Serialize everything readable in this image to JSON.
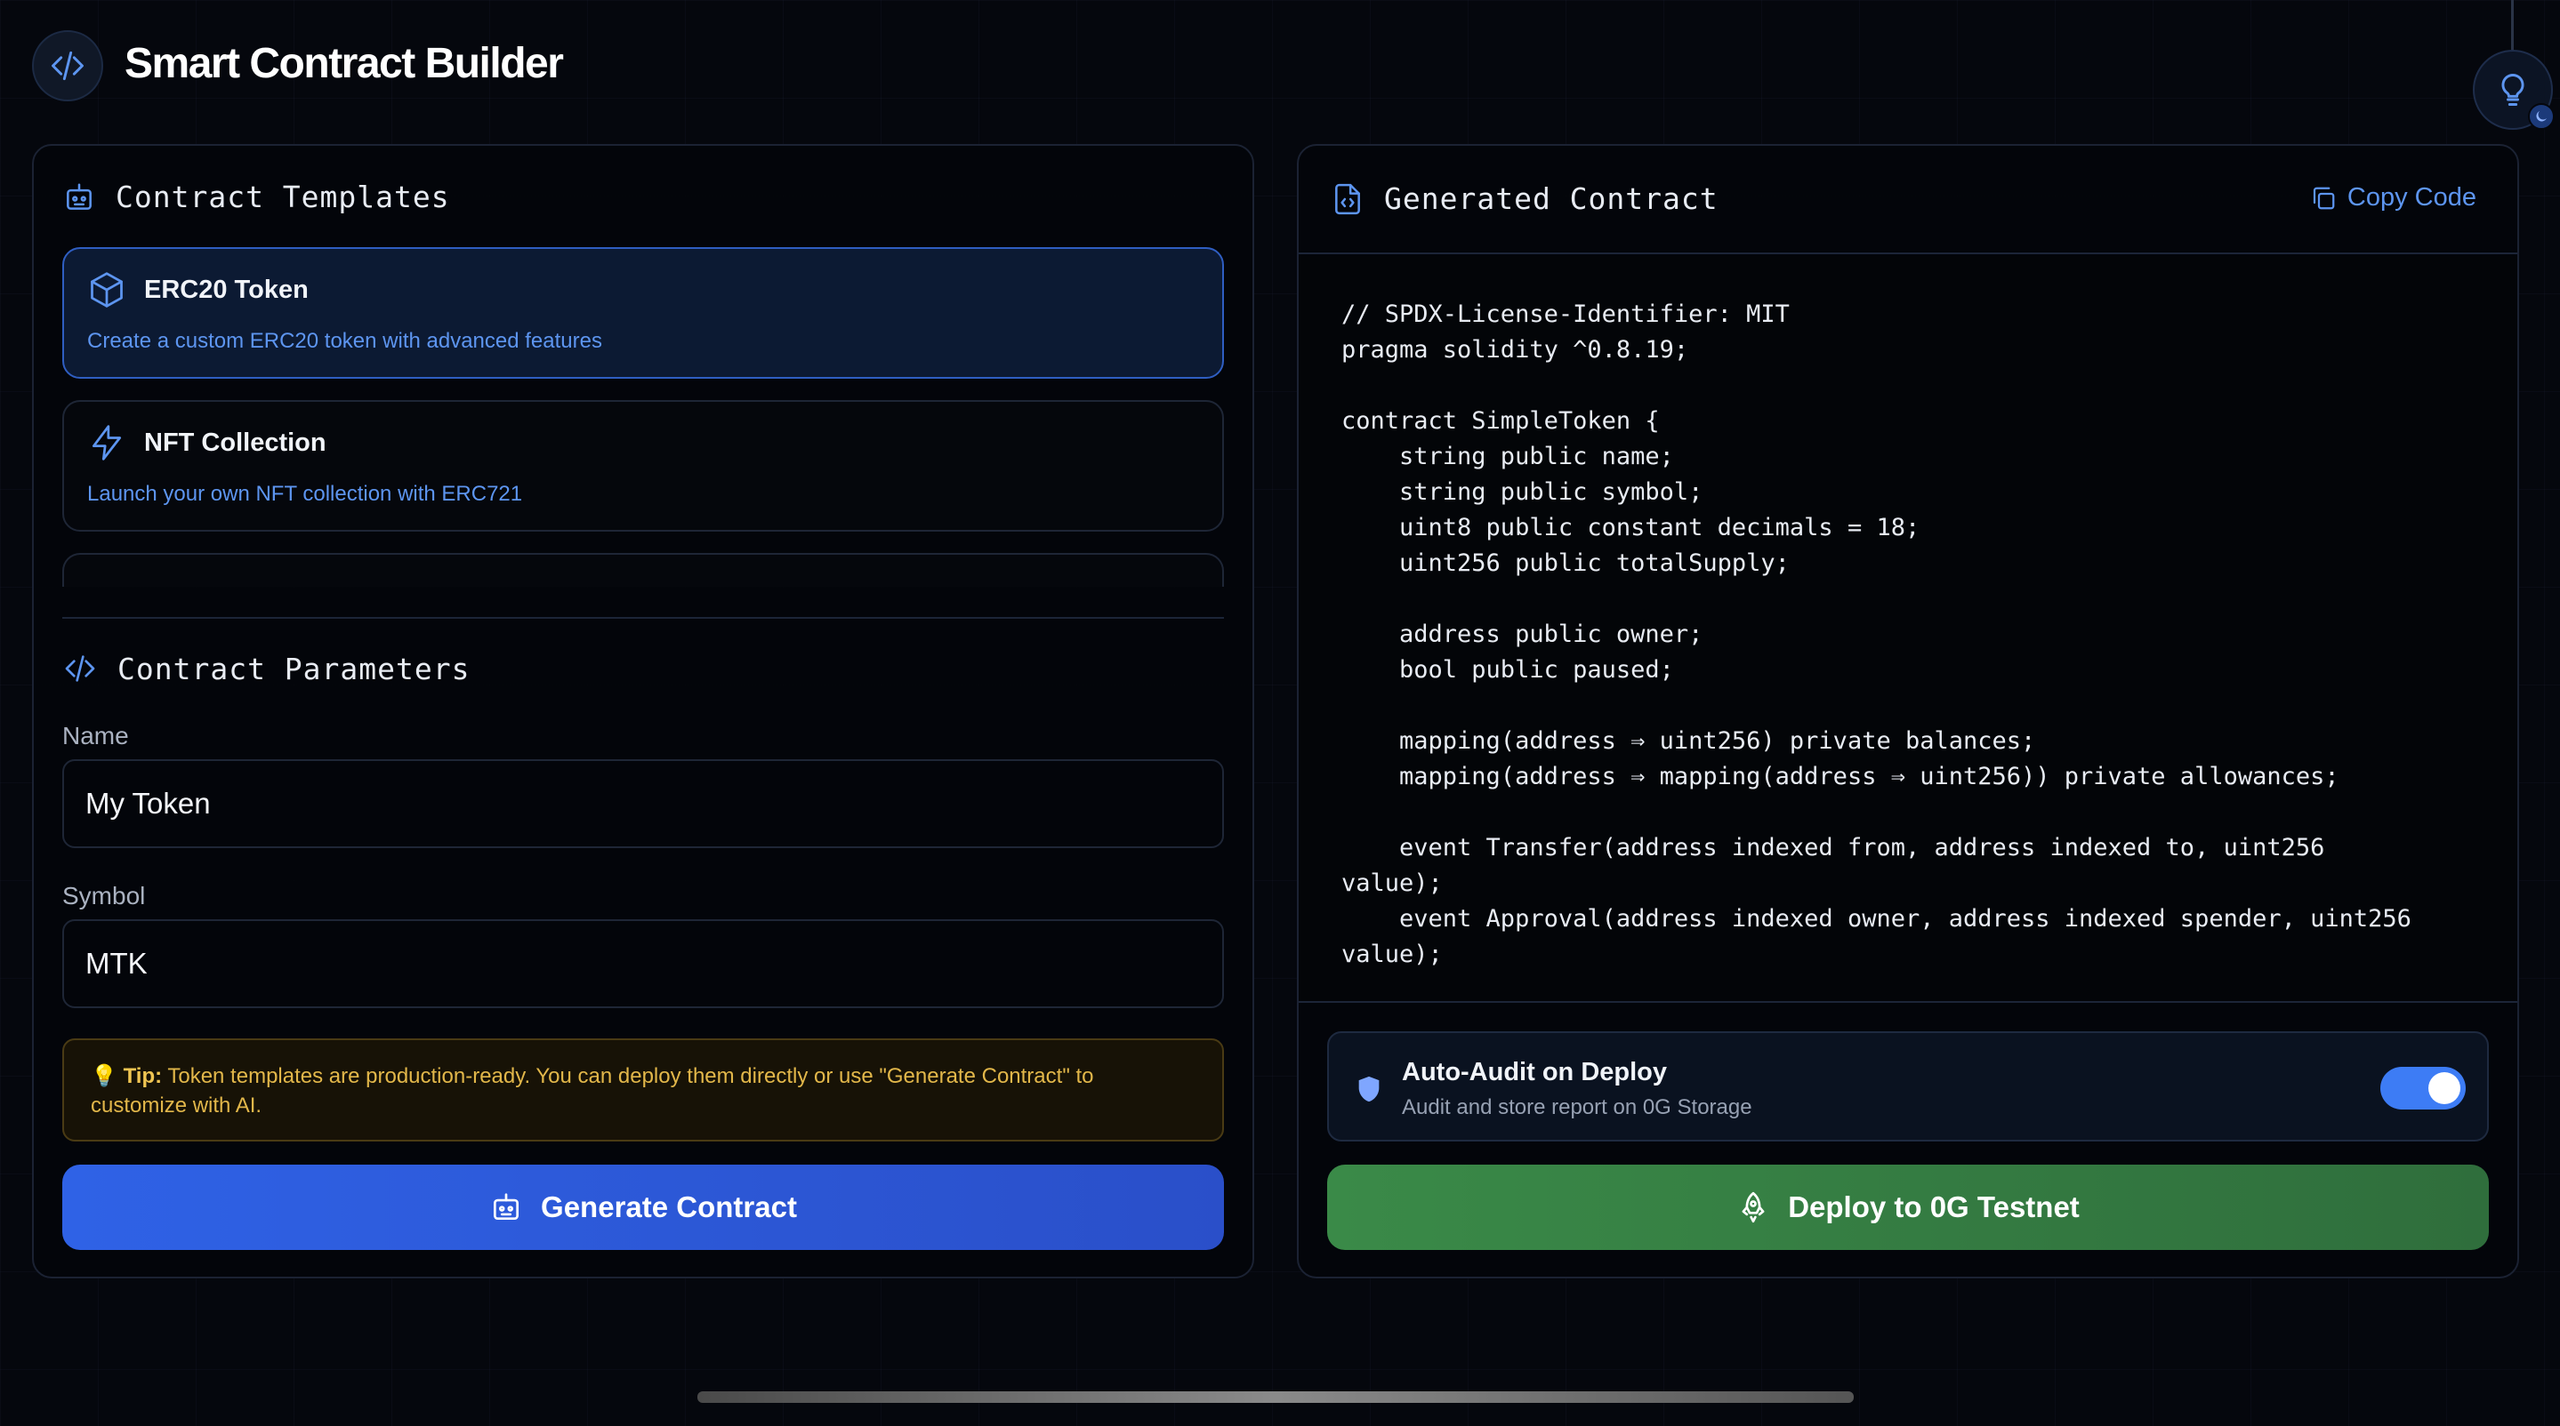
{
  "app": {
    "title": "Smart Contract Builder"
  },
  "templates": {
    "section_title": "Contract Templates",
    "items": [
      {
        "title": "ERC20 Token",
        "description": "Create a custom ERC20 token with advanced features",
        "active": true
      },
      {
        "title": "NFT Collection",
        "description": "Launch your own NFT collection with ERC721",
        "active": false
      }
    ]
  },
  "parameters": {
    "section_title": "Contract Parameters",
    "name_label": "Name",
    "name_value": "My Token",
    "symbol_label": "Symbol",
    "symbol_value": "MTK"
  },
  "tip": {
    "label": "Tip:",
    "text": "Token templates are production-ready. You can deploy them directly or use \"Generate Contract\" to customize with AI."
  },
  "generate_button": {
    "label": "Generate Contract"
  },
  "generated": {
    "section_title": "Generated Contract",
    "copy_label": "Copy Code",
    "code_lines": [
      "// SPDX-License-Identifier: MIT",
      "pragma solidity ^0.8.19;",
      "",
      "contract SimpleToken {",
      "    string public name;",
      "    string public symbol;",
      "    uint8 public constant decimals = 18;",
      "    uint256 public totalSupply;",
      "",
      "    address public owner;",
      "    bool public paused;",
      "",
      "    mapping(address ⇒ uint256) private balances;",
      "    mapping(address ⇒ mapping(address ⇒ uint256)) private allowances;",
      "",
      "    event Transfer(address indexed from, address indexed to, uint256",
      "value);",
      "    event Approval(address indexed owner, address indexed spender, uint256",
      "value);"
    ]
  },
  "audit": {
    "title": "Auto-Audit on Deploy",
    "subtitle": "Audit and store report on 0G Storage",
    "enabled": true
  },
  "deploy_button": {
    "label": "Deploy to 0G Testnet"
  },
  "colors": {
    "accent_blue": "#2f62e6",
    "deploy_green": "#3a8a48",
    "tip_amber": "#e2b74a",
    "link_blue": "#5d95f0"
  }
}
